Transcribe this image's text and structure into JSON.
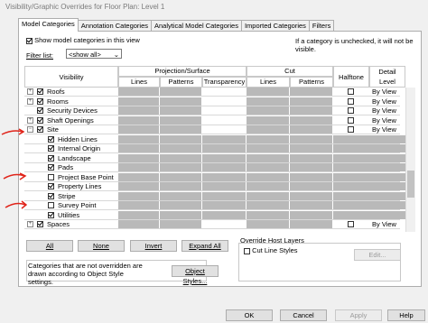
{
  "window_title": "Visibility/Graphic Overrides for Floor Plan: Level 1",
  "tabs": [
    "Model Categories",
    "Annotation Categories",
    "Analytical Model Categories",
    "Imported Categories",
    "Filters"
  ],
  "show_model_categories_label": "Show model categories in this view",
  "unchecked_note": "If a category is unchecked, it will not be visible.",
  "filter_list_label": "Filter list:",
  "filter_list_value": "<show all>",
  "table_headers": {
    "visibility": "Visibility",
    "projection_surface": "Projection/Surface",
    "lines": "Lines",
    "patterns": "Patterns",
    "transparency": "Transparency",
    "cut": "Cut",
    "cut_lines": "Lines",
    "cut_patterns": "Patterns",
    "halftone": "Halftone",
    "detail_level": "Detail Level"
  },
  "rows": [
    {
      "name": "Roofs",
      "indent": 0,
      "expander": "+",
      "checked": true,
      "detail": "By View"
    },
    {
      "name": "Rooms",
      "indent": 0,
      "expander": "+",
      "checked": true,
      "detail": "By View"
    },
    {
      "name": "Security Devices",
      "indent": 0,
      "expander": "",
      "checked": true,
      "detail": "By View"
    },
    {
      "name": "Shaft Openings",
      "indent": 0,
      "expander": "+",
      "checked": true,
      "detail": "By View"
    },
    {
      "name": "Site",
      "indent": 0,
      "expander": "−",
      "checked": true,
      "detail": "By View"
    },
    {
      "name": "Hidden Lines",
      "indent": 1,
      "expander": "",
      "checked": true,
      "detail": ""
    },
    {
      "name": "Internal Origin",
      "indent": 1,
      "expander": "",
      "checked": true,
      "detail": ""
    },
    {
      "name": "Landscape",
      "indent": 1,
      "expander": "",
      "checked": true,
      "detail": ""
    },
    {
      "name": "Pads",
      "indent": 1,
      "expander": "",
      "checked": true,
      "detail": ""
    },
    {
      "name": "Project Base Point",
      "indent": 1,
      "expander": "",
      "checked": false,
      "detail": ""
    },
    {
      "name": "Property Lines",
      "indent": 1,
      "expander": "",
      "checked": true,
      "detail": ""
    },
    {
      "name": "Stripe",
      "indent": 1,
      "expander": "",
      "checked": true,
      "detail": ""
    },
    {
      "name": "Survey Point",
      "indent": 1,
      "expander": "",
      "checked": false,
      "detail": ""
    },
    {
      "name": "Utilities",
      "indent": 1,
      "expander": "",
      "checked": true,
      "detail": ""
    },
    {
      "name": "Spaces",
      "indent": 0,
      "expander": "+",
      "checked": true,
      "detail": "By View"
    }
  ],
  "buttons": {
    "all": "All",
    "none": "None",
    "invert": "Invert",
    "expand_all": "Expand All",
    "object_styles": "Object Styles...",
    "edit": "Edit...",
    "ok": "OK",
    "cancel": "Cancel",
    "apply": "Apply",
    "help": "Help"
  },
  "override_host_layers": "Override Host Layers",
  "cut_line_styles": "Cut Line Styles",
  "categories_note": "Categories that are not overridden are drawn according to Object Style settings.",
  "colors": {
    "gray_cell": "#b9b9b9",
    "annotation_red": "#e0241a"
  }
}
